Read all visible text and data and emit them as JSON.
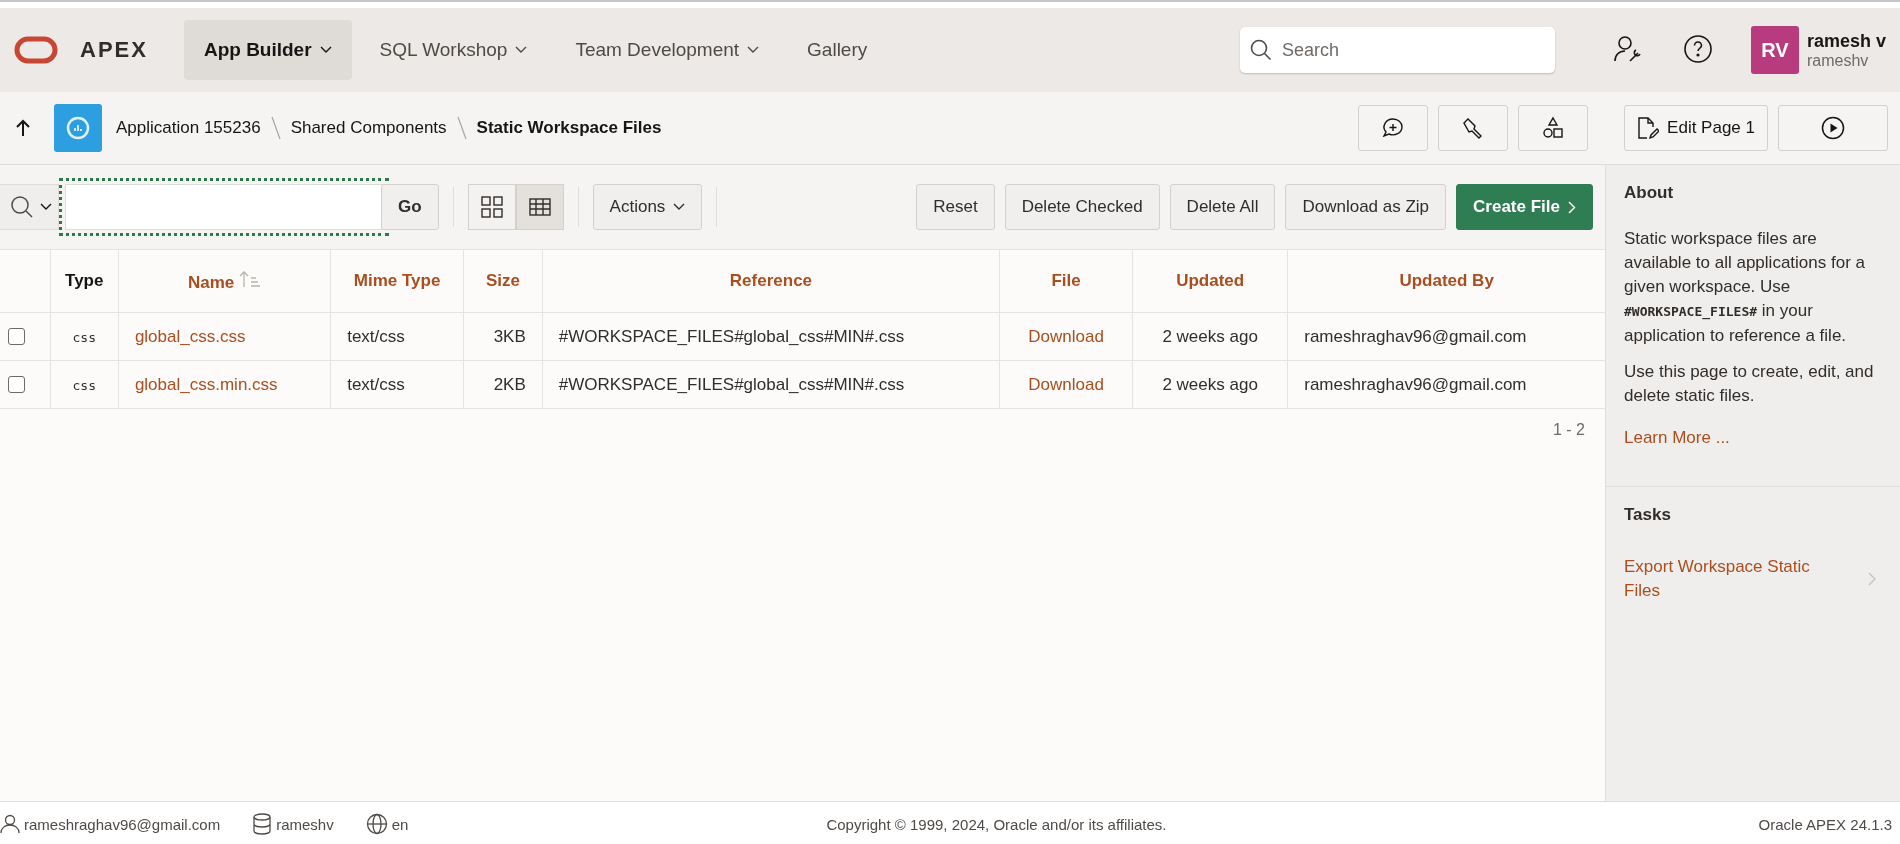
{
  "header": {
    "brand": "APEX",
    "nav": [
      {
        "label": "App Builder",
        "selected": true,
        "dropdown": true
      },
      {
        "label": "SQL Workshop",
        "selected": false,
        "dropdown": true
      },
      {
        "label": "Team Development",
        "selected": false,
        "dropdown": true
      },
      {
        "label": "Gallery",
        "selected": false,
        "dropdown": false
      }
    ],
    "search": {
      "placeholder": "Search"
    },
    "user": {
      "initials": "RV",
      "name": "ramesh v",
      "username": "rameshv"
    }
  },
  "breadcrumb": {
    "items": [
      {
        "label": "Application 155236",
        "current": false
      },
      {
        "label": "Shared Components",
        "current": false
      },
      {
        "label": "Static Workspace Files",
        "current": true
      }
    ],
    "edit_button": "Edit Page 1"
  },
  "toolbar": {
    "go": "Go",
    "views": [
      {
        "kind": "grid",
        "selected": false
      },
      {
        "kind": "table",
        "selected": true
      }
    ],
    "actions": "Actions",
    "buttons": [
      {
        "label": "Reset",
        "primary": false
      },
      {
        "label": "Delete Checked",
        "primary": false
      },
      {
        "label": "Delete All",
        "primary": false
      },
      {
        "label": "Download as Zip",
        "primary": false
      },
      {
        "label": "Create File",
        "primary": true
      }
    ]
  },
  "table": {
    "columns": [
      {
        "label": "Type",
        "sortable": false,
        "sorted": false
      },
      {
        "label": "Name",
        "sortable": true,
        "sorted": true
      },
      {
        "label": "Mime Type",
        "sortable": true,
        "sorted": false
      },
      {
        "label": "Size",
        "sortable": true,
        "sorted": false
      },
      {
        "label": "Reference",
        "sortable": true,
        "sorted": false
      },
      {
        "label": "File",
        "sortable": true,
        "sorted": false
      },
      {
        "label": "Updated",
        "sortable": true,
        "sorted": false
      },
      {
        "label": "Updated By",
        "sortable": true,
        "sorted": false
      }
    ],
    "rows": [
      {
        "checked": false,
        "type": "css",
        "name": "global_css.css",
        "mime_type": "text/css",
        "size": "3KB",
        "reference": "#WORKSPACE_FILES#global_css#MIN#.css",
        "file": "Download",
        "updated": "2 weeks ago",
        "updated_by": "rameshraghav96@gmail.com"
      },
      {
        "checked": false,
        "type": "css",
        "name": "global_css.min.css",
        "mime_type": "text/css",
        "size": "2KB",
        "reference": "#WORKSPACE_FILES#global_css#MIN#.css",
        "file": "Download",
        "updated": "2 weeks ago",
        "updated_by": "rameshraghav96@gmail.com"
      }
    ],
    "pagination": "1 - 2"
  },
  "sidebar": {
    "about_title": "About",
    "about_text": "Static workspace files are available to all applications for a given workspace. Use **#WORKSPACE_FILES#** in your application to reference a file.",
    "about_text_2": "Use this page to create, edit, and delete static files.",
    "learn_more": "Learn More ...",
    "tasks_title": "Tasks",
    "tasks": [
      "Export Workspace Static Files"
    ]
  },
  "footer": {
    "email": "rameshraghav96@gmail.com",
    "workspace": "rameshv",
    "language": "en",
    "copyright": "Copyright © 1999, 2024, Oracle and/or its affiliates.",
    "version": "Oracle APEX 24.1.3"
  }
}
